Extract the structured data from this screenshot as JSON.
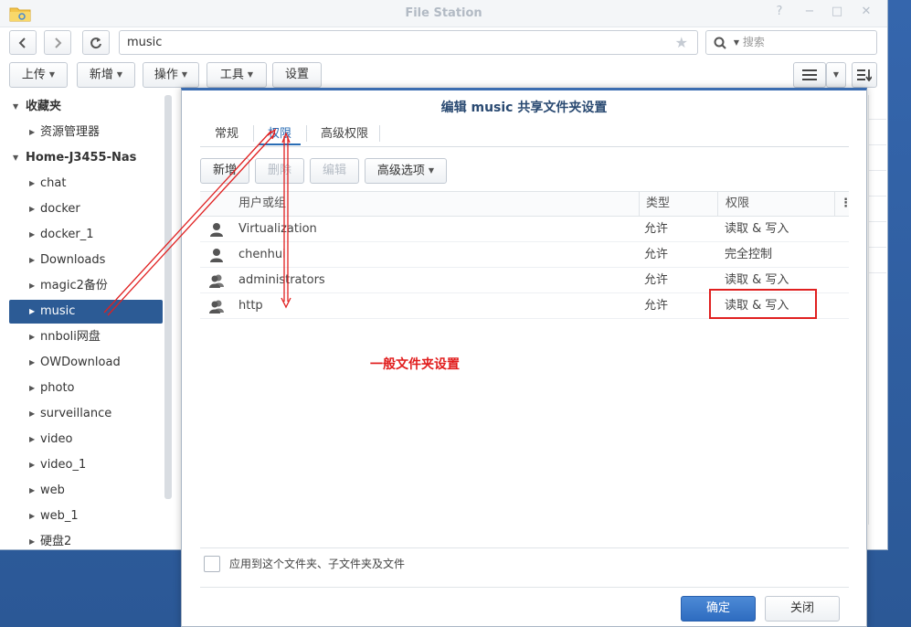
{
  "window": {
    "title": "File Station"
  },
  "nav": {
    "back": "<",
    "forward": ">",
    "refresh": "C"
  },
  "pathbar": {
    "value": "music"
  },
  "search": {
    "placeholder": "搜索"
  },
  "toolbar": {
    "upload": "上传",
    "create": "新增",
    "action": "操作",
    "tools": "工具",
    "settings": "设置"
  },
  "sidebar": {
    "favorites": {
      "label": "收藏夹",
      "items": [
        {
          "label": "资源管理器"
        }
      ]
    },
    "nas": {
      "label": "Home-J3455-Nas",
      "items": [
        {
          "label": "chat"
        },
        {
          "label": "docker"
        },
        {
          "label": "docker_1"
        },
        {
          "label": "Downloads"
        },
        {
          "label": "magic2备份"
        },
        {
          "label": "music",
          "selected": true
        },
        {
          "label": "nnboli网盘"
        },
        {
          "label": "OWDownload"
        },
        {
          "label": "photo"
        },
        {
          "label": "surveillance"
        },
        {
          "label": "video"
        },
        {
          "label": "video_1"
        },
        {
          "label": "web"
        },
        {
          "label": "web_1"
        },
        {
          "label": "硬盘2"
        }
      ]
    }
  },
  "dialog": {
    "title": "编辑 music 共享文件夹设置",
    "tabs": [
      {
        "label": "常规"
      },
      {
        "label": "权限"
      },
      {
        "label": "高级权限"
      }
    ],
    "active_tab": "权限",
    "buttons": {
      "create": "新增",
      "delete": "删除",
      "edit": "编辑",
      "advanced": "高级选项"
    },
    "columns": {
      "user": "用户或组",
      "type": "类型",
      "permission": "权限"
    },
    "rows": [
      {
        "name": "Virtualization",
        "type": "允许",
        "permission": "读取 & 写入",
        "icon": "user-icon"
      },
      {
        "name": "chenhui",
        "type": "允许",
        "permission": "完全控制",
        "icon": "user-icon"
      },
      {
        "name": "administrators",
        "type": "允许",
        "permission": "读取 & 写入",
        "icon": "group-icon"
      },
      {
        "name": "http",
        "type": "允许",
        "permission": "读取 & 写入",
        "icon": "group-icon"
      }
    ],
    "annotation": "一般文件夹设置",
    "apply_label": "应用到这个文件夹、子文件夹及文件",
    "ok": "确定",
    "cancel": "关闭"
  },
  "colors": {
    "accent": "#2c5b95",
    "annotation": "#e11d1d",
    "primary_button": "#2e6cc0"
  }
}
